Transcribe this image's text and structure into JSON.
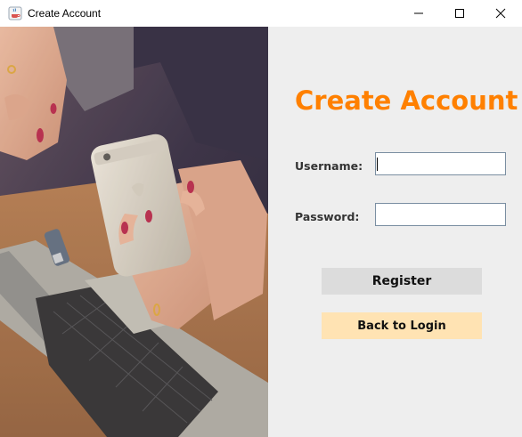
{
  "window": {
    "title": "Create Account",
    "icon": "java-cup-icon",
    "controls": [
      "minimize-icon",
      "maximize-icon",
      "close-icon"
    ]
  },
  "form": {
    "heading": "Create Account",
    "username_label": "Username:",
    "username_value": "",
    "password_label": "Password:",
    "password_value": "",
    "register_label": "Register",
    "back_label": "Back to Login"
  },
  "colors": {
    "accent": "#ff8000",
    "panel_bg": "#eeeeee",
    "register_bg": "#dcdcdc",
    "back_bg": "#ffe3b3"
  }
}
